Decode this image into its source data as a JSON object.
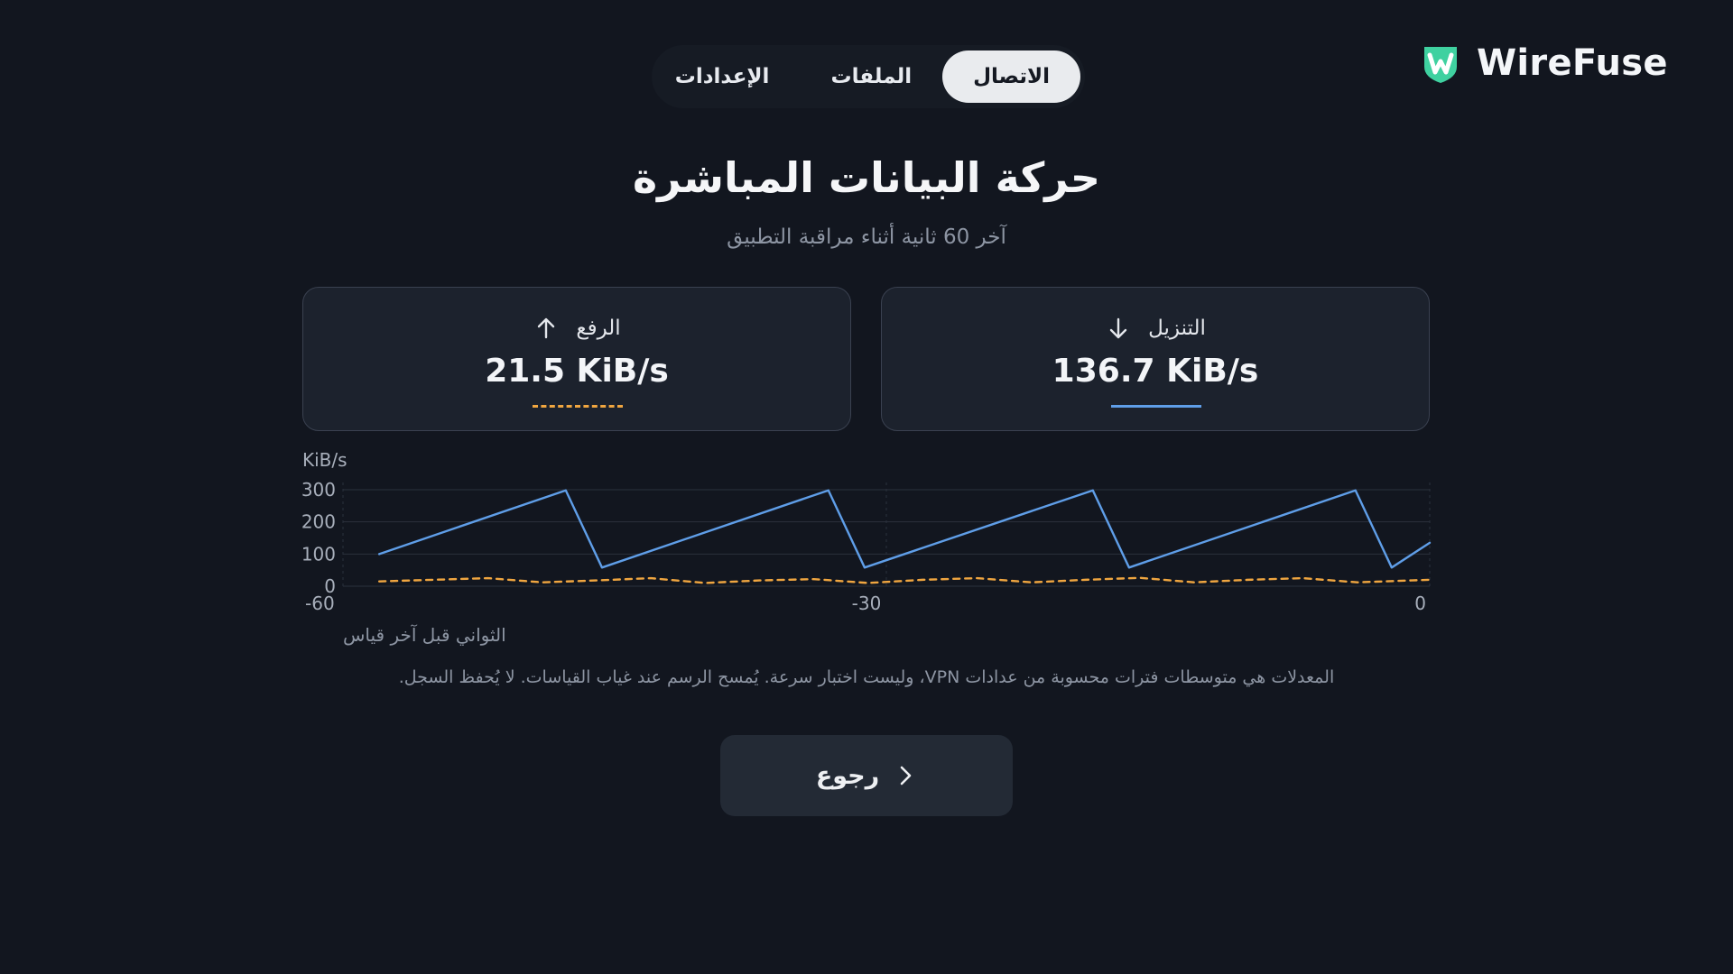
{
  "brand": {
    "name": "WireFuse",
    "accent": "#3fd1a0"
  },
  "tabs": [
    {
      "label": "الاتصال",
      "active": true
    },
    {
      "label": "الملفات",
      "active": false
    },
    {
      "label": "الإعدادات",
      "active": false
    }
  ],
  "header": {
    "title": "حركة البيانات المباشرة",
    "subtitle": "آخر 60 ثانية أثناء مراقبة التطبيق"
  },
  "stats": {
    "download": {
      "label": "التنزيل",
      "value": "136.7 KiB/s",
      "icon": "arrow-down-icon",
      "color": "#5f9ee8"
    },
    "upload": {
      "label": "الرفع",
      "value": "21.5 KiB/s",
      "icon": "arrow-up-icon",
      "color": "#f0a640"
    }
  },
  "chart_data": {
    "type": "line",
    "ylabel": "KiB/s",
    "xlabel": "الثواني قبل آخر قياس",
    "ylim": [
      0,
      300
    ],
    "xlim": [
      -60,
      0
    ],
    "yticks": [
      "300",
      "200",
      "100",
      "0"
    ],
    "xticks": [
      "-60",
      "-30",
      "0"
    ],
    "grid": true,
    "series": [
      {
        "name": "التنزيل",
        "color": "#5f9ee8",
        "style": "solid",
        "x": [
          -58,
          -47.7,
          -45.7,
          -33.2,
          -31.2,
          -18.6,
          -16.6,
          -4.1,
          -2.1,
          0
        ],
        "y": [
          100,
          298,
          58,
          298,
          58,
          298,
          58,
          298,
          58,
          135
        ]
      },
      {
        "name": "الرفع",
        "color": "#f0a640",
        "style": "dashed",
        "x": [
          -58,
          -55,
          -52,
          -49,
          -46,
          -43,
          -40,
          -37,
          -34,
          -31,
          -28,
          -25,
          -22,
          -19,
          -16,
          -13,
          -10,
          -7,
          -4,
          -1,
          0
        ],
        "y": [
          15,
          20,
          25,
          12,
          18,
          25,
          10,
          18,
          22,
          10,
          20,
          25,
          12,
          20,
          26,
          12,
          20,
          25,
          12,
          18,
          20
        ]
      }
    ]
  },
  "note": "المعدلات هي متوسطات فترات محسوبة من عدادات VPN، وليست اختبار سرعة. يُمسح الرسم عند غياب القياسات. لا يُحفظ السجل.",
  "back_button": {
    "label": "رجوع",
    "icon": "chevron-right-icon"
  }
}
